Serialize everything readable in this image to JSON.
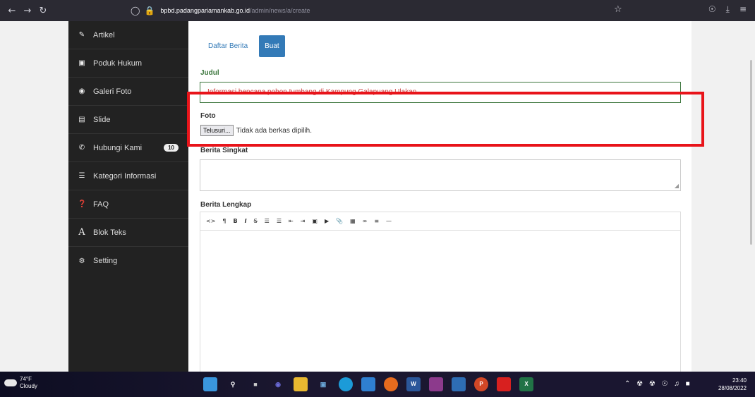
{
  "browser": {
    "url_host": "bpbd.padangpariamankab.go.id",
    "url_path": "/admin/news/a/create"
  },
  "sidebar": {
    "items": [
      {
        "label": "Artikel",
        "icon": "pencil-icon"
      },
      {
        "label": "Poduk Hukum",
        "icon": "save-icon"
      },
      {
        "label": "Galeri Foto",
        "icon": "camera-icon"
      },
      {
        "label": "Slide",
        "icon": "image-icon"
      },
      {
        "label": "Hubungi Kami",
        "icon": "phone-icon",
        "badge": "10"
      },
      {
        "label": "Kategori Informasi",
        "icon": "list-icon"
      },
      {
        "label": "FAQ",
        "icon": "question-icon"
      },
      {
        "label": "Blok Teks",
        "icon": "font-icon"
      },
      {
        "label": "Setting",
        "icon": "gear-icon"
      }
    ]
  },
  "tabs": {
    "list_label": "Daftar Berita",
    "create_label": "Buat"
  },
  "form": {
    "judul_label": "Judul",
    "judul_value": "Informasi bencana pohon tumbang di Kampung Galapuang Ulakan",
    "foto_label": "Foto",
    "file_button": "Telusuri...",
    "file_status": "Tidak ada berkas dipilih.",
    "singkat_label": "Berita Singkat",
    "lengkap_label": "Berita Lengkap"
  },
  "taskbar": {
    "temp": "74°F",
    "weather": "Cloudy",
    "time": "23:40",
    "date": "28/08/2022"
  },
  "colors": {
    "highlight": "#e8141a",
    "primary": "#337ab7"
  }
}
